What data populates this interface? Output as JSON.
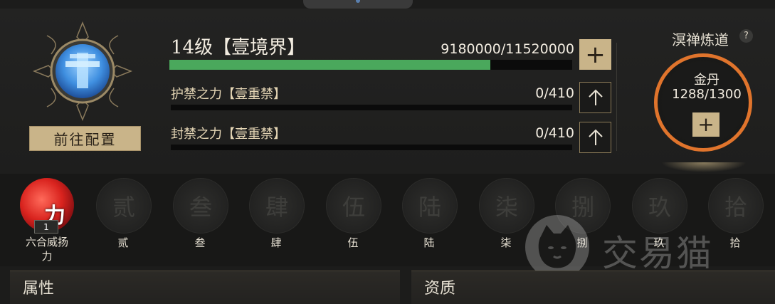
{
  "header": {
    "level_title": "14级【壹境界】",
    "exp_text": "9180000/11520000",
    "exp_progress": 0.797,
    "add_label": "+"
  },
  "forces": [
    {
      "label": "护禁之力【壹重禁】",
      "value": "0/410"
    },
    {
      "label": "封禁之力【壹重禁】",
      "value": "0/410"
    }
  ],
  "left": {
    "config_button": "前往配置",
    "emblem_icon": "sword-emblem-icon"
  },
  "meditation": {
    "title": "溟禅炼道",
    "help": "?",
    "ring_title": "金丹",
    "ring_value": "1288/1300",
    "plus": "+",
    "ring_color": "#e0742c"
  },
  "skills": {
    "active": {
      "label_line1": "六合威扬",
      "label_line2": "力",
      "glyph": "力",
      "level": "1"
    },
    "slots": [
      {
        "glyph": "贰",
        "label": "贰"
      },
      {
        "glyph": "叁",
        "label": "叁"
      },
      {
        "glyph": "肆",
        "label": "肆"
      },
      {
        "glyph": "伍",
        "label": "伍"
      },
      {
        "glyph": "陆",
        "label": "陆"
      },
      {
        "glyph": "柒",
        "label": "柒"
      },
      {
        "glyph": "捌",
        "label": "捌"
      },
      {
        "glyph": "玖",
        "label": "玖"
      },
      {
        "glyph": "拾",
        "label": "拾"
      }
    ]
  },
  "watermark": {
    "text": "交易猫"
  },
  "tabs": {
    "attributes": "属性",
    "aptitude": "资质"
  },
  "colors": {
    "gold": "#c9b489",
    "exp_green": "#4aa85c",
    "ring_orange": "#e0742c"
  }
}
